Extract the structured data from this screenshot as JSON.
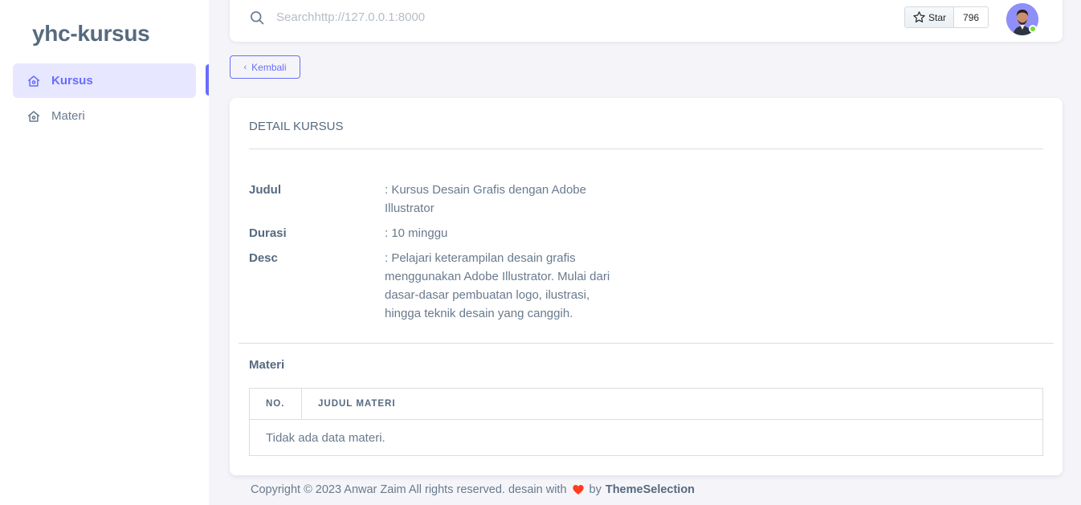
{
  "sidebar": {
    "brand": "yhc-kursus",
    "items": [
      {
        "label": "Kursus",
        "icon": "home-icon",
        "active": true
      },
      {
        "label": "Materi",
        "icon": "home-icon",
        "active": false
      }
    ]
  },
  "navbar": {
    "search_placeholder": "Searchhttp://127.0.0.1:8000",
    "github_star_label": "Star",
    "github_star_count": "796"
  },
  "back_button": {
    "label": "Kembali"
  },
  "card": {
    "title": "DETAIL KURSUS",
    "details": [
      {
        "label": "Judul",
        "value": ": Kursus Desain Grafis dengan Adobe Illustrator"
      },
      {
        "label": "Durasi",
        "value": ": 10 minggu"
      },
      {
        "label": "Desc",
        "value": ": Pelajari keterampilan desain grafis menggunakan Adobe Illustrator. Mulai dari dasar-dasar pembuatan logo, ilustrasi, hingga teknik desain yang canggih."
      }
    ],
    "materi_title": "Materi",
    "table": {
      "columns": [
        "NO.",
        "JUDUL MATERI"
      ],
      "empty_text": "Tidak ada data materi."
    }
  },
  "footer": {
    "text": "Copyright © 2023 Anwar Zaim All rights reserved. desain with",
    "by": "by",
    "brand": "ThemeSelection"
  },
  "colors": {
    "primary": "#696cff",
    "heart": "#ff3e1d",
    "online": "#71dd37"
  }
}
